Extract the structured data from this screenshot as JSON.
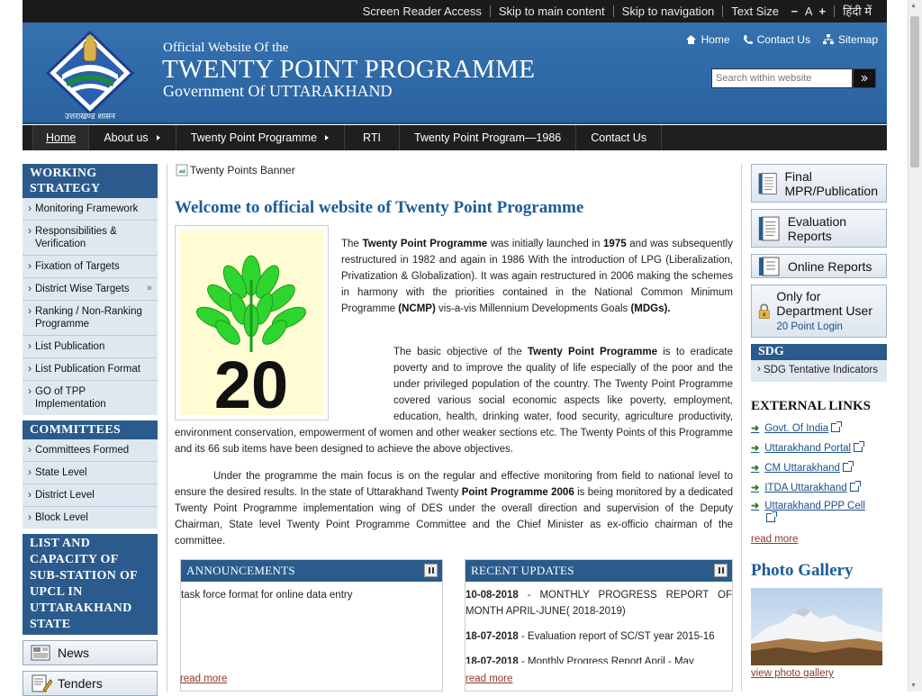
{
  "topbar": {
    "screen_reader": "Screen Reader Access",
    "skip_main": "Skip to main content",
    "skip_nav": "Skip to navigation",
    "text_size": "Text Size",
    "minus": "−",
    "a": "A",
    "plus": "+",
    "hindi": "हिंदी में"
  },
  "header": {
    "logo_caption": "उत्तराखण्ड शासन",
    "small": "Official Website Of the",
    "title": "TWENTY POINT PROGRAMME",
    "gov": "Government Of UTTARAKHAND",
    "links": {
      "home": "Home",
      "contact": "Contact Us",
      "sitemap": "Sitemap"
    },
    "search_placeholder": "Search within website"
  },
  "nav": {
    "items": [
      "Home",
      "About us",
      "Twenty Point Programme",
      "RTI",
      "Twenty Point Program—1986",
      "Contact Us"
    ]
  },
  "left": {
    "working_head": "WORKING STRATEGY",
    "working_items": [
      "Monitoring Framework",
      "Responsibilities & Verification",
      "Fixation of Targets",
      "District Wise Targets",
      "Ranking / Non-Ranking Programme",
      "List Publication",
      "List Publication Format",
      "GO of TPP Implementation"
    ],
    "committees_head": "COMMITTEES",
    "committees_items": [
      "Committees Formed",
      "State Level",
      "District Level",
      "Block Level"
    ],
    "list_head": "LIST AND CAPACITY OF SUB-STATION OF UPCL IN UTTARAKHAND STATE",
    "news": "News",
    "tenders": "Tenders"
  },
  "main": {
    "banner_alt": "Twenty Points Banner",
    "welcome": "Welcome to official website of Twenty Point Programme",
    "emblem_number": "20",
    "p1": {
      "a": "The ",
      "b1": "Twenty Point Programme",
      "c": " was initially launched in ",
      "b2": "1975",
      "d": " and was subsequently restructured in 1982 and again in 1986 With the introduction of LPG (Liberalization, Privatization & Globalization). It was again restructured in 2006 making the schemes in harmony with the priorities contained in the National Common Minimum Programme ",
      "b3": "(NCMP)",
      "e": " vis-a-vis Millennium Developments Goals ",
      "b4": "(MDGs)."
    },
    "p2": {
      "a": "The basic objective of the ",
      "b1": "Twenty Point Programme",
      "c": " is to eradicate poverty and to improve the quality of life especially of the poor and the under privileged population of the country. The Twenty Point Programme covered various social economic aspects like poverty, employment, education, health, drinking water, food security, agriculture productivity, environment conservation, empowerment of women and other weaker sections etc. The Twenty Points of this Programme and its 66 sub items have been designed to achieve the above objectives."
    },
    "p3": {
      "a": "Under the programme the main focus is on the regular and effective monitoring from field to national level to ensure the desired results. In the state of Uttarakhand Twenty ",
      "b1": "Point Programme 2006",
      "c": " is being monitored by a dedicated Twenty Point Programme implementation wing of DES under the overall direction and supervision of the Deputy Chairman, State level Twenty Point Programme Committee and the Chief Minister as ex-officio chairman of the committee."
    },
    "announcements": {
      "title": "ANNOUNCEMENTS",
      "items": [
        "task force format for online data entry"
      ],
      "read_more": "read more"
    },
    "updates": {
      "title": "RECENT UPDATES",
      "items": [
        {
          "date": "10-08-2018",
          "text": " - MONTHLY PROGRESS REPORT OF MONTH APRIL-JUNE( 2018-2019)"
        },
        {
          "date": "18-07-2018",
          "text": " - Evaluation report of SC/ST year 2015-16"
        },
        {
          "date": "18-07-2018",
          "text": " - Monthly Progress Report April - May"
        }
      ],
      "read_more": "read more"
    }
  },
  "right": {
    "tiles": [
      "Final MPR/Publication",
      "Evaluation Reports",
      "Online Reports"
    ],
    "login_text": "Only for Department User",
    "login_link": "20 Point Login",
    "sdg_head": "SDG",
    "sdg_item": "SDG Tentative Indicators",
    "ext_head": "EXTERNAL LINKS",
    "ext_links": [
      "Govt. Of India",
      "Uttarakhand Portal",
      "CM Uttarakhand",
      "ITDA Uttarakhand",
      "Uttarakhand PPP Cell"
    ],
    "read_more": "read more",
    "gallery_head": "Photo Gallery",
    "gallery_link": "view photo gallery"
  }
}
